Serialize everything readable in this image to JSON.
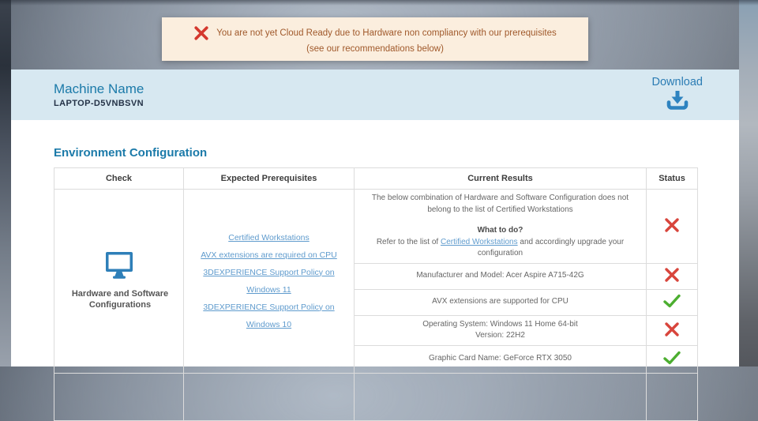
{
  "banner": {
    "icon": "error-x",
    "line1": "You are not yet Cloud Ready due to Hardware non compliancy with our prerequisites",
    "line2": "(see our recommendations below)"
  },
  "header": {
    "machine_label": "Machine Name",
    "machine_value": "LAPTOP-D5VNBSVN",
    "download_label": "Download",
    "download_icon": "download-arrow-into-tray"
  },
  "section_title": "Environment Configuration",
  "table": {
    "columns": [
      "Check",
      "Expected Prerequisites",
      "Current Results",
      "Status"
    ],
    "check_group": {
      "icon": "monitor",
      "label": "Hardware and Software Configurations"
    },
    "prerequisites": [
      "Certified Workstations",
      "AVX extensions are required on CPU",
      "3DEXPERIENCE Support Policy on Windows 11",
      "3DEXPERIENCE Support Policy on Windows 10"
    ],
    "results": [
      {
        "lines": [
          "The below combination of Hardware and Software Configuration does not belong to the list of Certified Workstations"
        ],
        "what_to_do": "What to do?",
        "refer_prefix": "Refer to the list of ",
        "refer_link": "Certified Workstations",
        "refer_suffix": " and accordingly upgrade your configuration",
        "status": "fail"
      },
      {
        "lines": [
          "Manufacturer and Model: Acer Aspire A715-42G"
        ],
        "status": "fail"
      },
      {
        "lines": [
          "AVX extensions are supported for CPU"
        ],
        "status": "pass"
      },
      {
        "lines": [
          "Operating System: Windows 11 Home 64-bit",
          "Version: 22H2"
        ],
        "status": "fail"
      },
      {
        "lines": [
          "Graphic Card Name: GeForce RTX 3050"
        ],
        "status": "pass"
      }
    ]
  },
  "icons": {
    "status_fail": "x-mark",
    "status_pass": "check-mark"
  },
  "colors": {
    "accent_blue": "#1b7aa9",
    "link_blue": "#5f9bcd",
    "fail_red": "#d8453c",
    "pass_green": "#4cae30",
    "banner_bg": "#fbeede",
    "banner_text": "#a0592b",
    "header_bg": "#d7e8f1",
    "icon_blue": "#2e7fb8"
  }
}
